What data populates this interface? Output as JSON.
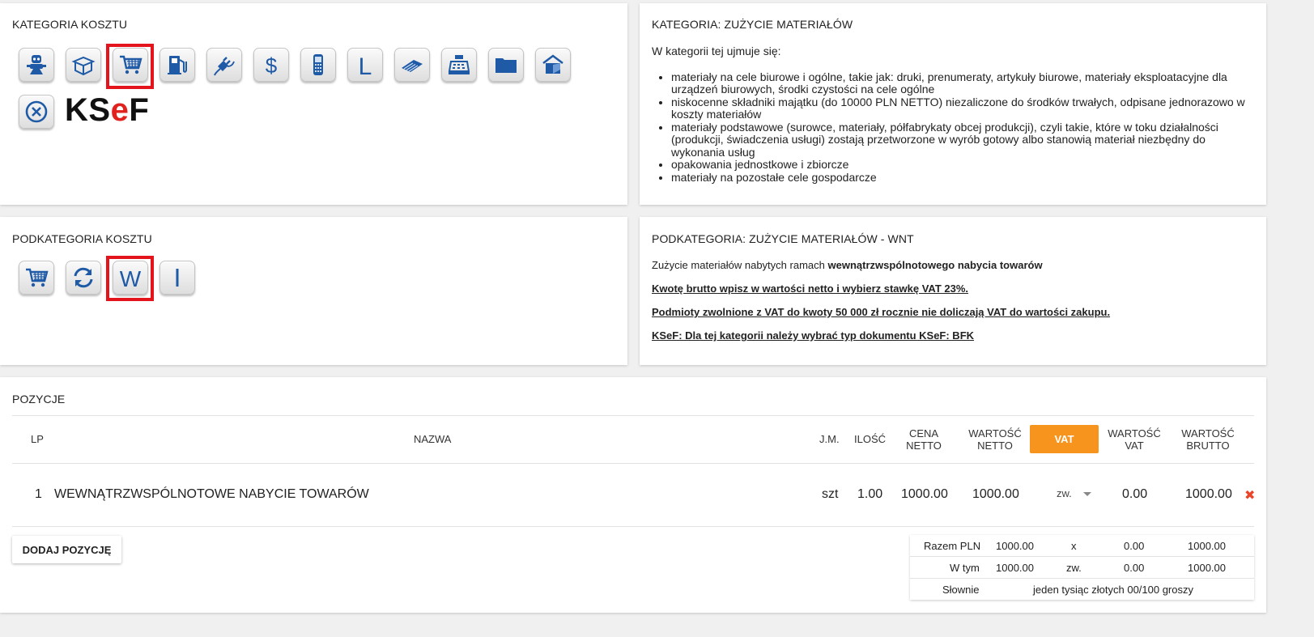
{
  "kategoria": {
    "title": "KATEGORIA KOSZTU",
    "icons": [
      "robot-icon",
      "box-icon",
      "cart-icon",
      "fuel-icon",
      "plug-icon",
      "dollar-icon",
      "phone-icon",
      "letter-l-icon",
      "calculator-icon",
      "cash-register-icon",
      "folder-icon",
      "house-icon",
      "cancel-icon"
    ],
    "selected": "cart-icon",
    "ksef_logo": {
      "k": "KS",
      "e": "e",
      "f": "F"
    }
  },
  "kategoria_desc": {
    "title": "KATEGORIA: ZUŻYCIE MATERIAŁÓW",
    "intro": "W kategorii tej ujmuje się:",
    "items": [
      "materiały na cele biurowe i ogólne, takie jak: druki, prenumeraty, artykuły biurowe, materiały eksploatacyjne dla urządzeń biurowych, środki czystości na cele ogólne",
      "niskocenne składniki majątku (do 10000 PLN NETTO) niezaliczone do środków trwałych, odpisane jednorazowo w koszty materiałów",
      "materiały podstawowe (surowce, materiały, półfabrykaty obcej produkcji), czyli takie, które w toku działalności (produkcji, świadczenia usługi) zostają przetworzone w wyrób gotowy albo stanowią materiał niezbędny do wykonania usług",
      "opakowania jednostkowe i zbiorcze",
      "materiały na pozostałe cele gospodarcze"
    ]
  },
  "podkategoria": {
    "title": "PODKATEGORIA KOSZTU",
    "icons": [
      "cart-icon",
      "refresh-icon",
      "letter-w-icon",
      "letter-i-icon"
    ],
    "selected": "letter-w-icon"
  },
  "podkategoria_desc": {
    "title": "PODKATEGORIA: ZUŻYCIE MATERIAŁÓW - WNT",
    "line1_pre": "Zużycie materiałów nabytych ramach ",
    "line1_bold": "wewnątrzwspólnotowego nabycia towarów",
    "line2": "Kwotę brutto wpisz w wartości netto i wybierz stawkę VAT 23%.",
    "line3": "Podmioty zwolnione z VAT do kwoty 50 000 zł rocznie nie doliczają VAT do wartości zakupu.",
    "line4": "KSeF: Dla tej kategorii należy wybrać typ dokumentu KSeF: BFK"
  },
  "pozycje": {
    "title": "POZYCJE",
    "headers": {
      "lp": "LP",
      "nazwa": "NAZWA",
      "jm": "J.M.",
      "ilosc": "ILOŚĆ",
      "cena1": "CENA",
      "cena2": "NETTO",
      "wn1": "WARTOŚĆ",
      "wn2": "NETTO",
      "vat": "VAT",
      "wv1": "WARTOŚĆ",
      "wv2": "VAT",
      "wb1": "WARTOŚĆ",
      "wb2": "BRUTTO"
    },
    "rows": [
      {
        "lp": "1",
        "nazwa": "WEWNĄTRZWSPÓLNOTOWE NABYCIE TOWARÓW",
        "jm": "szt",
        "ilosc": "1.00",
        "cena": "1000.00",
        "wartosc_netto": "1000.00",
        "vat": "zw.",
        "wartosc_vat": "0.00",
        "wartosc_brutto": "1000.00",
        "delete": "✖"
      }
    ],
    "add_label": "DODAJ POZYCJĘ"
  },
  "summary": {
    "razem": {
      "label": "Razem PLN",
      "netto": "1000.00",
      "vat_rate": "x",
      "vat": "0.00",
      "brutto": "1000.00"
    },
    "wtym": {
      "label": "W tym",
      "netto": "1000.00",
      "vat_rate": "zw.",
      "vat": "0.00",
      "brutto": "1000.00"
    },
    "slownie": {
      "label": "Słownie",
      "value": "jeden tysiąc złotych 00/100 groszy"
    }
  },
  "colors": {
    "accent": "#f7941d",
    "selection": "#e3141c",
    "icon_blue": "#1f5aa6",
    "delete": "#e8452a"
  }
}
